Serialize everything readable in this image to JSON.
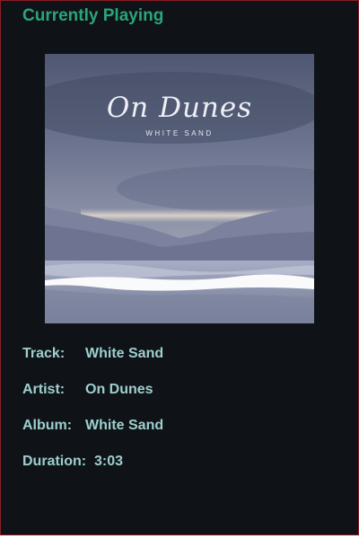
{
  "header": {
    "title": "Currently Playing"
  },
  "artwork": {
    "artist_text": "On Dunes",
    "album_text": "WHITE SAND"
  },
  "track_info": {
    "track_label": "Track:",
    "track_value": "White Sand",
    "artist_label": "Artist:",
    "artist_value": "On Dunes",
    "album_label": "Album:",
    "album_value": "White Sand",
    "duration_label": "Duration:",
    "duration_value": "3:03"
  },
  "colors": {
    "background": "#0f1317",
    "border": "#8a1c24",
    "title": "#2aa57a",
    "info_text": "#9ecfcf"
  }
}
